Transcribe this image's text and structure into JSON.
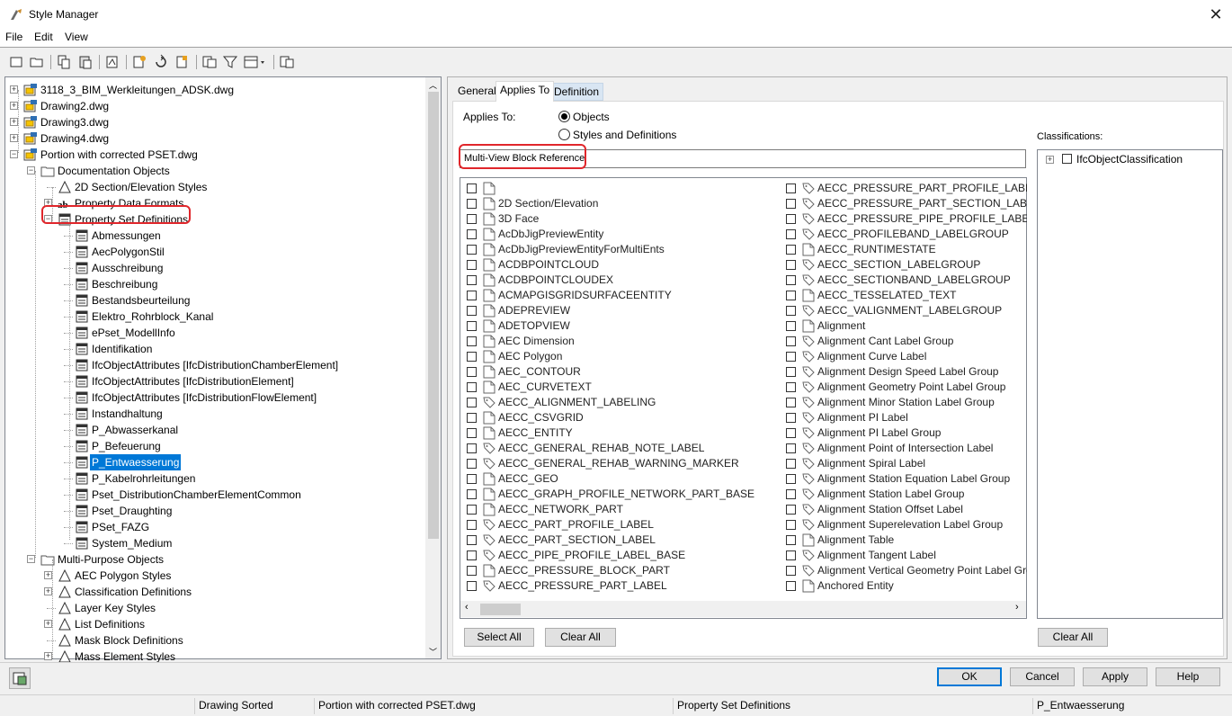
{
  "window": {
    "title": "Style Manager",
    "close_glyph": "✕"
  },
  "menu": [
    "File",
    "Edit",
    "View"
  ],
  "tree": {
    "drawings": [
      "3118_3_BIM_Werkleitungen_ADSK.dwg",
      "Drawing2.dwg",
      "Drawing3.dwg",
      "Drawing4.dwg",
      "Portion with corrected PSET.dwg"
    ],
    "documentation_objects": "Documentation Objects",
    "doc_children": [
      "2D Section/Elevation Styles",
      "Property Data Formats",
      "Property Set Definitions"
    ],
    "psets": [
      "Abmessungen",
      "AecPolygonStil",
      "Ausschreibung",
      "Beschreibung",
      "Bestandsbeurteilung",
      "Elektro_Rohrblock_Kanal",
      "ePset_ModellInfo",
      "Identifikation",
      "IfcObjectAttributes [IfcDistributionChamberElement]",
      "IfcObjectAttributes [IfcDistributionElement]",
      "IfcObjectAttributes [IfcDistributionFlowElement]",
      "Instandhaltung",
      "P_Abwasserkanal",
      "P_Befeuerung",
      "P_Entwaesserung",
      "P_Kabelrohrleitungen",
      "Pset_DistributionChamberElementCommon",
      "Pset_Draughting",
      "PSet_FAZG",
      "System_Medium"
    ],
    "multi_purpose": "Multi-Purpose Objects",
    "mp_children": [
      "AEC Polygon Styles",
      "Classification Definitions",
      "Layer Key Styles",
      "List Definitions",
      "Mask Block Definitions",
      "Mass Element Styles"
    ],
    "selected": "P_Entwaesserung"
  },
  "tabs": [
    "General",
    "Applies To",
    "Definition"
  ],
  "applies_to": {
    "label": "Applies To:",
    "options": [
      "Objects",
      "Styles and Definitions"
    ],
    "selected": "Objects",
    "filter_value": "Multi-View Block Reference",
    "classifications_label": "Classifications:",
    "classification_item": "IfcObjectClassification"
  },
  "object_list_col1": [
    "",
    "2D Section/Elevation",
    "3D Face",
    "AcDbJigPreviewEntity",
    "AcDbJigPreviewEntityForMultiEnts",
    "ACDBPOINTCLOUD",
    "ACDBPOINTCLOUDEX",
    "ACMAPGISGRIDSURFACEENTITY",
    "ADEPREVIEW",
    "ADETOPVIEW",
    "AEC Dimension",
    "AEC Polygon",
    "AEC_CONTOUR",
    "AEC_CURVETEXT",
    "AECC_ALIGNMENT_LABELING",
    "AECC_CSVGRID",
    "AECC_ENTITY",
    "AECC_GENERAL_REHAB_NOTE_LABEL",
    "AECC_GENERAL_REHAB_WARNING_MARKER",
    "AECC_GEO",
    "AECC_GRAPH_PROFILE_NETWORK_PART_BASE",
    "AECC_NETWORK_PART",
    "AECC_PART_PROFILE_LABEL",
    "AECC_PART_SECTION_LABEL",
    "AECC_PIPE_PROFILE_LABEL_BASE",
    "AECC_PRESSURE_BLOCK_PART",
    "AECC_PRESSURE_PART_LABEL"
  ],
  "object_list_col2": [
    "AECC_PRESSURE_PART_PROFILE_LABEL",
    "AECC_PRESSURE_PART_SECTION_LABEL",
    "AECC_PRESSURE_PIPE_PROFILE_LABEL_Base",
    "AECC_PROFILEBAND_LABELGROUP",
    "AECC_RUNTIMESTATE",
    "AECC_SECTION_LABELGROUP",
    "AECC_SECTIONBAND_LABELGROUP",
    "AECC_TESSELATED_TEXT",
    "AECC_VALIGNMENT_LABELGROUP",
    "Alignment",
    "Alignment Cant Label Group",
    "Alignment Curve Label",
    "Alignment Design Speed Label Group",
    "Alignment Geometry Point Label Group",
    "Alignment Minor Station Label Group",
    "Alignment PI Label",
    "Alignment PI Label Group",
    "Alignment Point of Intersection Label",
    "Alignment Spiral Label",
    "Alignment Station Equation Label Group",
    "Alignment Station Label Group",
    "Alignment Station Offset Label",
    "Alignment Superelevation Label Group",
    "Alignment Table",
    "Alignment Tangent Label",
    "Alignment Vertical Geometry Point Label Gro",
    "Anchored Entity"
  ],
  "buttons": {
    "select_all": "Select All",
    "clear_all": "Clear All",
    "clear_all_class": "Clear All",
    "ok": "OK",
    "cancel": "Cancel",
    "apply": "Apply",
    "help": "Help"
  },
  "status": [
    "Drawing Sorted",
    "Portion with corrected PSET.dwg",
    "Property Set Definitions",
    "P_Entwaesserung"
  ],
  "colors": {
    "selection": "#0078d7",
    "highlight_box": "#e0262b"
  }
}
